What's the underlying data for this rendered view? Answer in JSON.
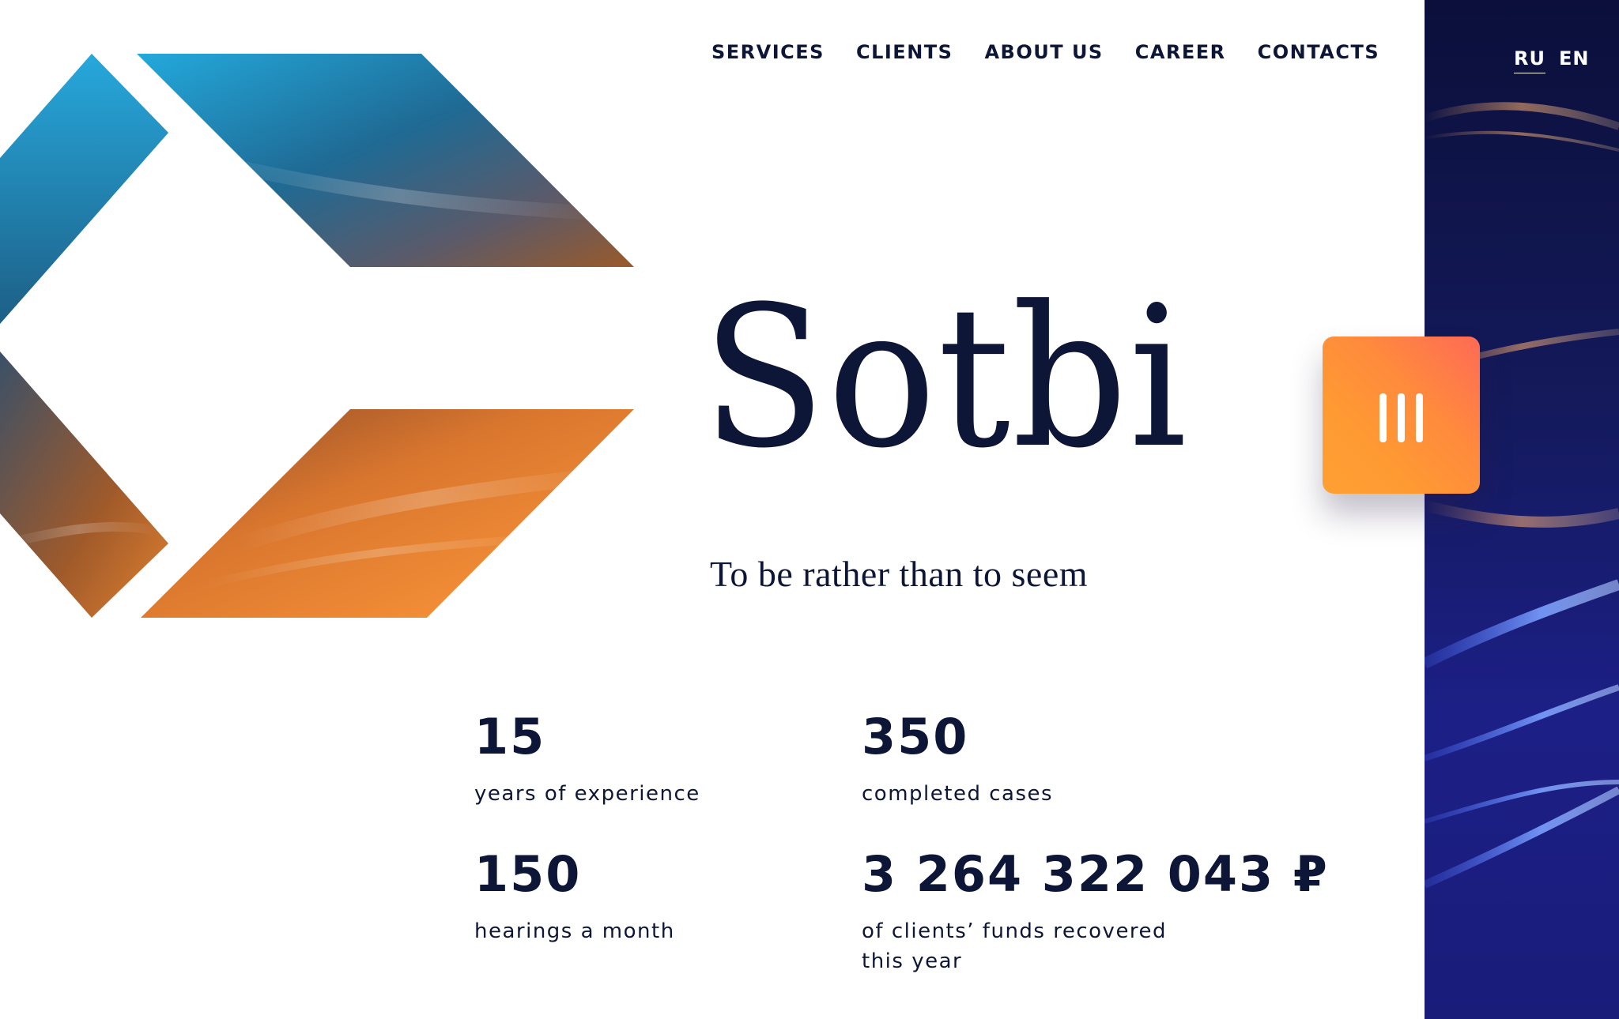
{
  "nav": {
    "items": [
      {
        "label": "SERVICES"
      },
      {
        "label": "CLIENTS"
      },
      {
        "label": "ABOUT US"
      },
      {
        "label": "CAREER"
      },
      {
        "label": "CONTACTS"
      }
    ]
  },
  "language": {
    "ru": "RU",
    "en": "EN",
    "active": "RU"
  },
  "hero": {
    "title": "Sotbi",
    "tagline": "To be rather than to seem"
  },
  "stats": [
    {
      "value": "15",
      "label": "years of experience"
    },
    {
      "value": "350",
      "label": "completed cases"
    },
    {
      "value": "150",
      "label": "hearings a month"
    },
    {
      "value": "3 264 322 043 ₽",
      "label": "of clients’ funds recovered this year"
    }
  ],
  "menu": {
    "icon": "three-vertical-bars-icon"
  },
  "colors": {
    "text": "#0e1638",
    "accent_orange": "#ff9a33",
    "accent_blue": "#22a6db",
    "panel_dark": "#0b0f3a"
  }
}
